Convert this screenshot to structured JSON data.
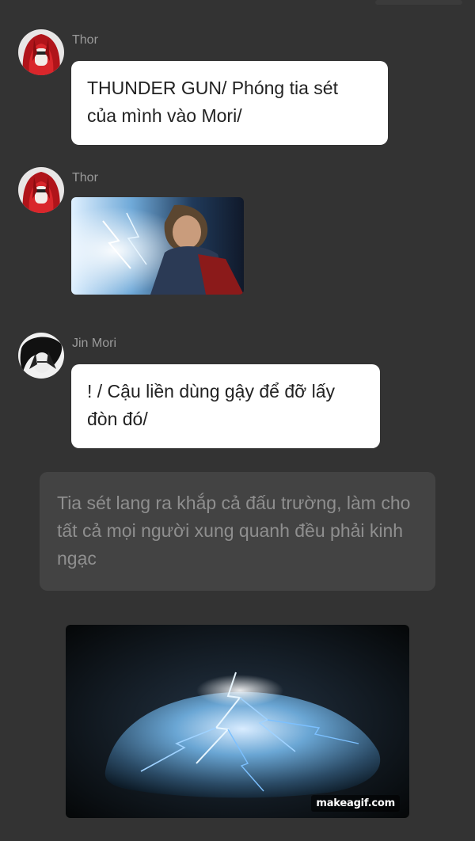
{
  "chat": {
    "messages": [
      {
        "author": "Thor",
        "avatar_icon": "red-haired-avatar-icon",
        "text": "THUNDER GUN/ Phóng tia sét của mình vào Mori/"
      },
      {
        "author": "Thor",
        "avatar_icon": "red-haired-avatar-icon",
        "media": "thor-lightning-image"
      },
      {
        "author": "Jin Mori",
        "avatar_icon": "dark-haired-avatar-icon",
        "text": "! / Cậu liền dùng gậy để đỡ lấy đòn đó/"
      }
    ],
    "narration": "Tia sét lang ra khắp cả đấu trường, làm cho tất cả mọi người xung quanh đều phải kinh ngạc",
    "final_gif": {
      "watermark": "makeagif.com",
      "description_icon": "lightning-rock-gif"
    }
  },
  "colors": {
    "background": "#333333",
    "bubble": "#ffffff",
    "narration_bg": "#434343",
    "username": "#9a9a9a"
  }
}
